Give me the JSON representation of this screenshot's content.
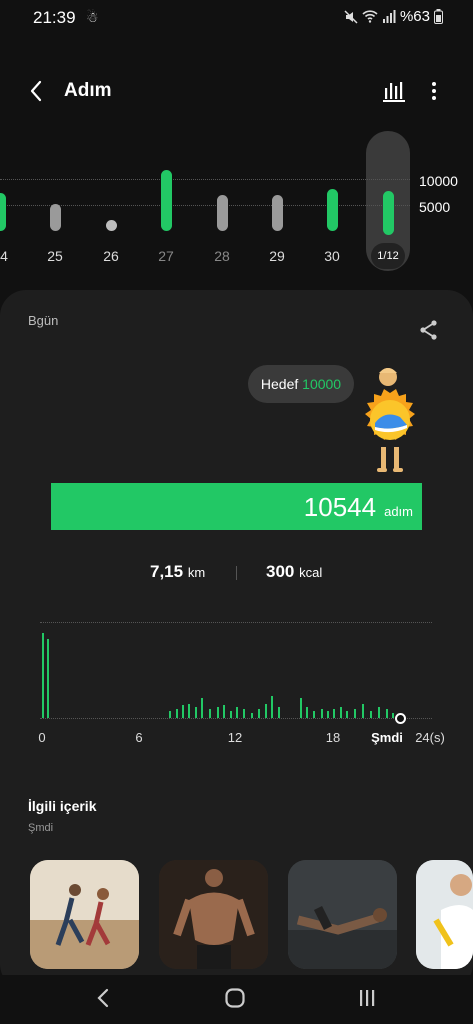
{
  "status": {
    "time": "21:39",
    "battery": "%63"
  },
  "header": {
    "title": "Adım"
  },
  "week": {
    "goal_labels": [
      "10000",
      "5000"
    ],
    "days": [
      {
        "label": "4",
        "level": 0.45,
        "color": "#22c865"
      },
      {
        "label": "25",
        "level": 0.32,
        "color": "#9a9a9a"
      },
      {
        "label": "26",
        "level": 0.0,
        "color": "#bdbdbd"
      },
      {
        "label": "27",
        "level": 0.72,
        "color": "#22c865"
      },
      {
        "label": "28",
        "level": 0.42,
        "color": "#9a9a9a"
      },
      {
        "label": "29",
        "level": 0.42,
        "color": "#9a9a9a"
      },
      {
        "label": "30",
        "level": 0.5,
        "color": "#22c865"
      }
    ],
    "selected_badge": "1/12",
    "selected_level": 0.52
  },
  "card": {
    "title": "Bgün",
    "goal_prefix": "Hedef",
    "goal_value": "10000",
    "steps": "10544",
    "steps_unit": "adım",
    "distance": "7,15",
    "distance_unit": "km",
    "calories": "300",
    "calories_unit": "kcal"
  },
  "hourly": {
    "axis_labels": [
      "0",
      "6",
      "12",
      "18",
      "Şmdi",
      "24(s)"
    ],
    "now_hour": 22.5,
    "bars": [
      {
        "hour": 0.0,
        "level": 0.95
      },
      {
        "hour": 0.3,
        "level": 0.88
      },
      {
        "hour": 8.0,
        "level": 0.08
      },
      {
        "hour": 8.4,
        "level": 0.1
      },
      {
        "hour": 8.8,
        "level": 0.14
      },
      {
        "hour": 9.2,
        "level": 0.16
      },
      {
        "hour": 9.6,
        "level": 0.12
      },
      {
        "hour": 10.0,
        "level": 0.22
      },
      {
        "hour": 10.5,
        "level": 0.1
      },
      {
        "hour": 11.0,
        "level": 0.12
      },
      {
        "hour": 11.4,
        "level": 0.14
      },
      {
        "hour": 11.8,
        "level": 0.08
      },
      {
        "hour": 12.2,
        "level": 0.12
      },
      {
        "hour": 12.6,
        "level": 0.1
      },
      {
        "hour": 13.1,
        "level": 0.06
      },
      {
        "hour": 13.6,
        "level": 0.1
      },
      {
        "hour": 14.0,
        "level": 0.16
      },
      {
        "hour": 14.4,
        "level": 0.24
      },
      {
        "hour": 14.8,
        "level": 0.12
      },
      {
        "hour": 16.2,
        "level": 0.22
      },
      {
        "hour": 16.6,
        "level": 0.12
      },
      {
        "hour": 17.0,
        "level": 0.08
      },
      {
        "hour": 17.5,
        "level": 0.1
      },
      {
        "hour": 17.9,
        "level": 0.08
      },
      {
        "hour": 18.3,
        "level": 0.1
      },
      {
        "hour": 18.7,
        "level": 0.12
      },
      {
        "hour": 19.1,
        "level": 0.08
      },
      {
        "hour": 19.6,
        "level": 0.1
      },
      {
        "hour": 20.1,
        "level": 0.16
      },
      {
        "hour": 20.6,
        "level": 0.08
      },
      {
        "hour": 21.1,
        "level": 0.12
      },
      {
        "hour": 21.6,
        "level": 0.1
      },
      {
        "hour": 22.0,
        "level": 0.06
      }
    ]
  },
  "related": {
    "title": "İlgili içerik",
    "subtitle": "Şmdi"
  },
  "thumbnails": [
    {
      "name": "running-couple-image",
      "bg": "#c8b9a2"
    },
    {
      "name": "muscular-man-image",
      "bg": "#3a2c22"
    },
    {
      "name": "gym-workout-image",
      "bg": "#3e4244"
    },
    {
      "name": "fitness-woman-image",
      "bg": "#dfe4e6"
    }
  ]
}
